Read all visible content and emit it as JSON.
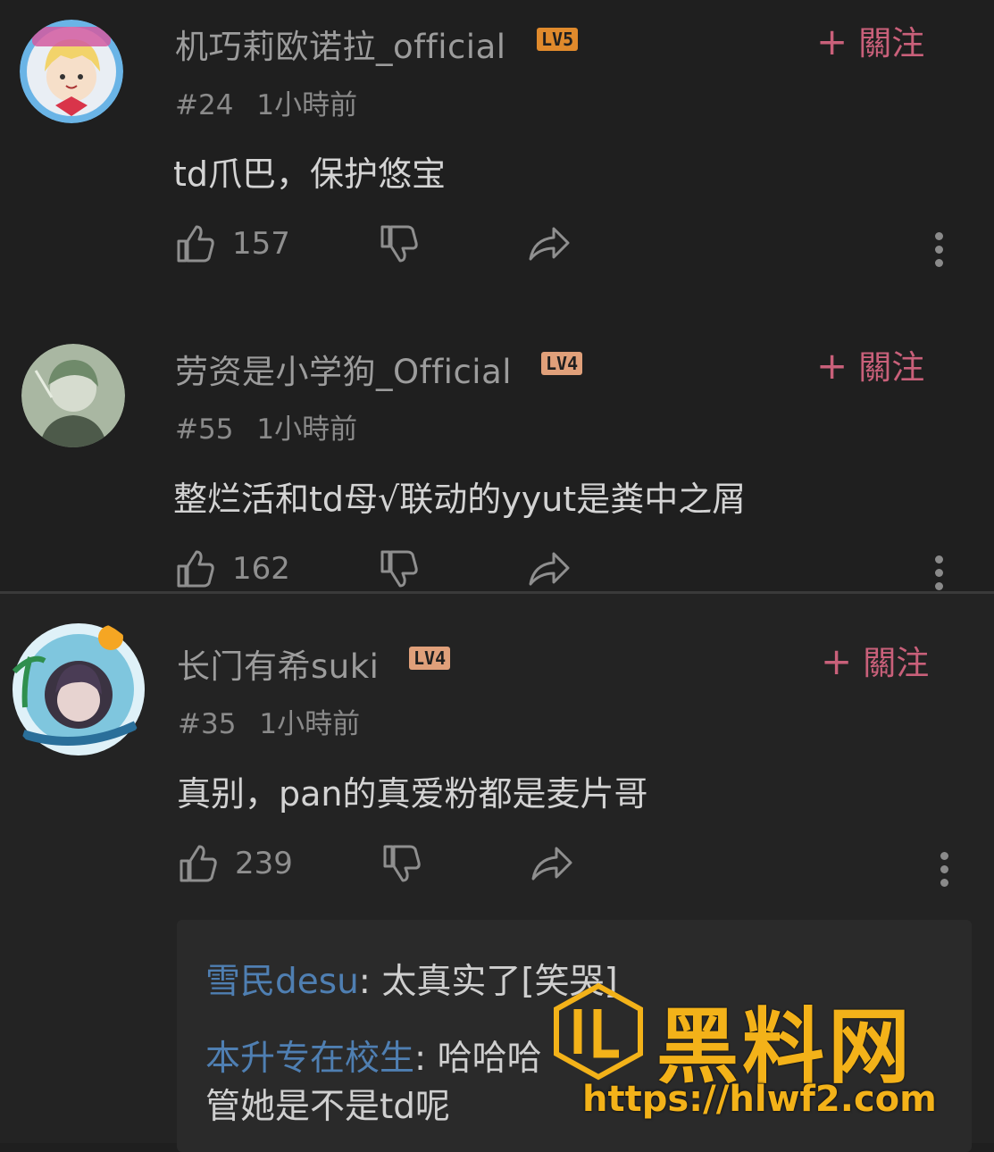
{
  "comments": [
    {
      "username": "机巧莉欧诺拉_official",
      "level": "LV5",
      "level_color": "#e08a2c",
      "follow_label": "關注",
      "floor": "#24",
      "time": "1小時前",
      "text": "td爪巴，保护悠宝",
      "likes": "157"
    },
    {
      "username": "劳资是小学狗_Official",
      "level": "LV4",
      "level_color": "#e0a07a",
      "follow_label": "關注",
      "floor": "#55",
      "time": "1小時前",
      "text": "整烂活和td母√联动的yyut是粪中之屑",
      "likes": "162"
    },
    {
      "username": "长门有希suki",
      "level": "LV4",
      "level_color": "#e0a07a",
      "follow_label": "關注",
      "floor": "#35",
      "time": "1小時前",
      "text": "真别，pan的真爱粉都是麦片哥",
      "likes": "239"
    }
  ],
  "replies": [
    {
      "user": "雪民desu",
      "text": "太真实了[笑哭]"
    },
    {
      "user": "本升专在校生",
      "text": "哈哈哈",
      "text2": "管她是不是td呢"
    }
  ],
  "watermark": {
    "title": "黑料网",
    "url": "https://hlwf2.com"
  },
  "colors": {
    "background": "#1f1f1f",
    "follow": "#c9607a",
    "reply_user": "#4f7fb2",
    "watermark": "#f3b219"
  }
}
